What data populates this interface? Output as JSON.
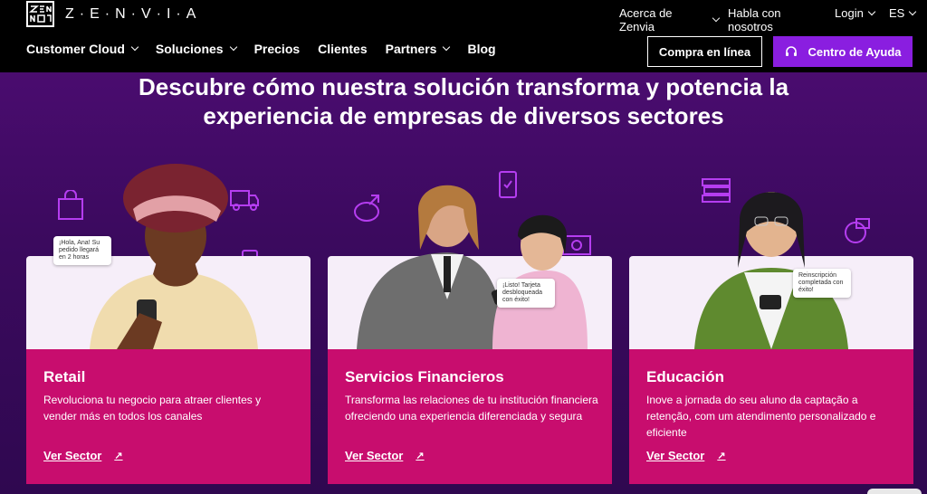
{
  "brand": {
    "name": "Z·E·N·V·I·A"
  },
  "top_links": [
    {
      "label": "Acerca de Zenvia",
      "has_chevron": true
    },
    {
      "label": "Habla con nosotros",
      "has_chevron": false
    },
    {
      "label": "Login",
      "has_chevron": true
    },
    {
      "label": "ES",
      "has_chevron": true
    }
  ],
  "nav": {
    "items": [
      {
        "label": "Customer Cloud",
        "has_chevron": true
      },
      {
        "label": "Soluciones",
        "has_chevron": true
      },
      {
        "label": "Precios",
        "has_chevron": false
      },
      {
        "label": "Clientes",
        "has_chevron": false
      },
      {
        "label": "Partners",
        "has_chevron": true
      },
      {
        "label": "Blog",
        "has_chevron": false
      }
    ],
    "buy_label": "Compra en línea",
    "help_label": "Centro de Ayuda"
  },
  "hero": {
    "heading_line1": "Descubre cómo nuestra solución transforma y potencia la",
    "heading_line2": "experiencia de empresas de diversos sectores"
  },
  "cards": [
    {
      "title": "Retail",
      "description": "Revoluciona tu negocio para atraer clientes y vender más en todos los canales",
      "link_label": "Ver Sector",
      "bubble": "¡Hola, Ana! Su pedido llegará en 2 horas"
    },
    {
      "title": "Servicios Financieros",
      "description": "Transforma las relaciones de tu institución financiera ofreciendo una experiencia diferenciada y segura",
      "link_label": "Ver Sector",
      "bubble": "¡Listo! Tarjeta desbloqueada con éxito!"
    },
    {
      "title": "Educación",
      "description": "Inove a jornada do seu aluno da captação a retenção, com um atendimento personalizado e eficiente",
      "link_label": "Ver Sector",
      "bubble": "Reinscripción completada con éxito!"
    }
  ],
  "colors": {
    "accent_purple": "#8a1ee0",
    "card_magenta": "#c80d6e",
    "hero_bg": "#3b0a5e"
  }
}
